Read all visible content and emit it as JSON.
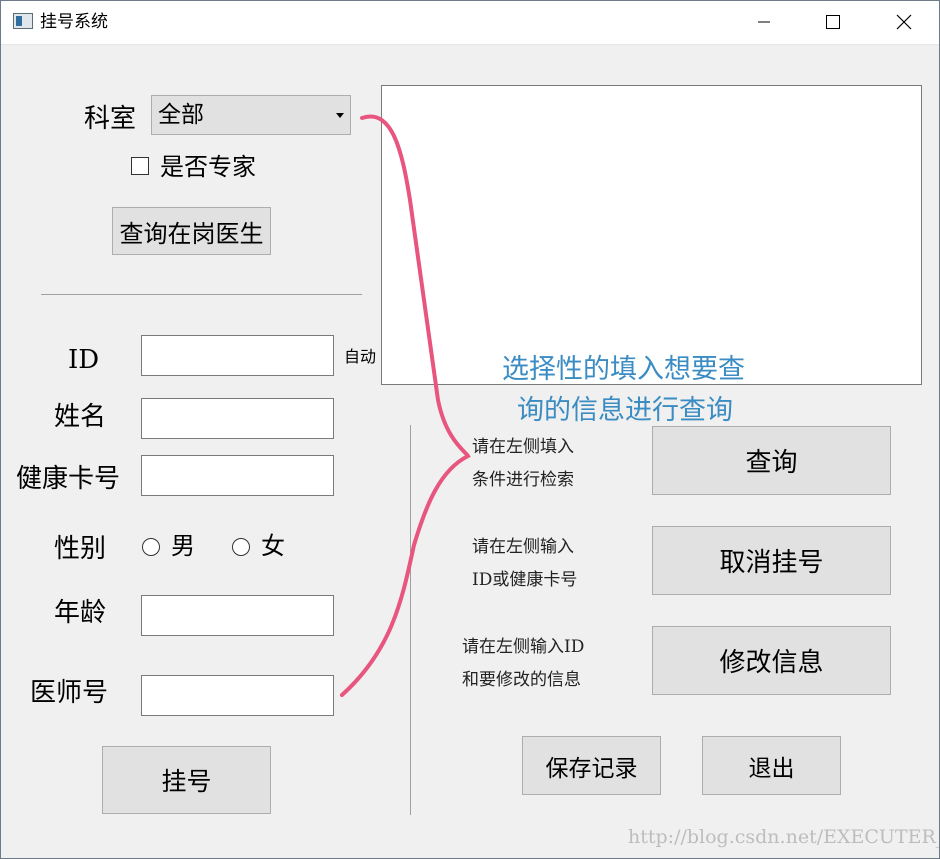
{
  "window": {
    "title": "挂号系统",
    "controls": {
      "minimize": "—",
      "maximize": "☐",
      "close": "✕"
    }
  },
  "search": {
    "department_label": "科室",
    "department_value": "全部",
    "expert_checkbox_label": "是否专家",
    "expert_checked": false,
    "query_doctors_button": "查询在岗医生"
  },
  "form": {
    "id_label": "ID",
    "id_auto_note": "自动",
    "id_value": "",
    "name_label": "姓名",
    "name_value": "",
    "health_card_label": "健康卡号",
    "health_card_value": "",
    "gender_label": "性别",
    "gender_male": "男",
    "gender_female": "女",
    "age_label": "年龄",
    "age_value": "",
    "doctor_no_label": "医师号",
    "doctor_no_value": "",
    "register_button": "挂号"
  },
  "annotation": {
    "line1": "选择性的填入想要查",
    "line2": "询的信息进行查询",
    "color": "#3a8cc3",
    "arrow_color": "#e8557e"
  },
  "actions": {
    "query_hint_1": "请在左侧填入",
    "query_hint_2": "条件进行检索",
    "query_button": "查询",
    "cancel_hint_1": "请在左侧输入",
    "cancel_hint_2": "ID或健康卡号",
    "cancel_button": "取消挂号",
    "modify_hint_1": "请在左侧输入ID",
    "modify_hint_2": "和要修改的信息",
    "modify_button": "修改信息",
    "save_button": "保存记录",
    "exit_button": "退出"
  },
  "watermark": "http://blog.csdn.net/EXECUTER_"
}
